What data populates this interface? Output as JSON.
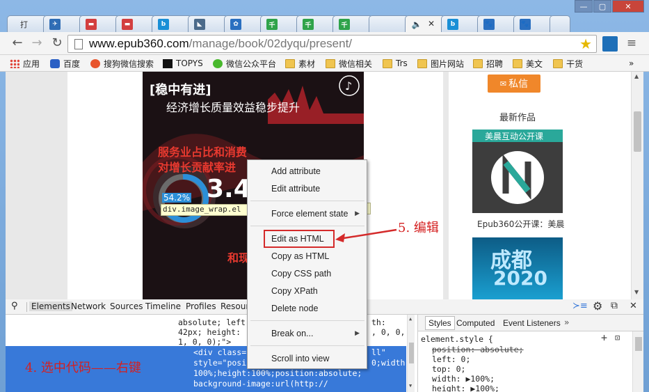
{
  "tabs": [
    {
      "label": "打",
      "color": "#9aa7b8"
    },
    {
      "label": "",
      "color": "#2f6db5"
    },
    {
      "label": "",
      "color": "#d33f3f"
    },
    {
      "label": "",
      "color": "#d33f3f"
    },
    {
      "label": "",
      "color": "#1a8fd6"
    },
    {
      "label": "",
      "color": "#4b6a8a"
    },
    {
      "label": "",
      "color": "#2a6fc0"
    },
    {
      "label": "",
      "color": "#2fa34a"
    },
    {
      "label": "",
      "color": "#2fa34a"
    },
    {
      "label": "",
      "color": "#2fa34a"
    },
    {
      "label": "",
      "color": "#333333"
    },
    {
      "label": "",
      "color": "#1a8fd6"
    },
    {
      "label": "",
      "color": "#2a6fc0"
    },
    {
      "label": "",
      "color": "#2a6fc0"
    }
  ],
  "address_bar": {
    "domain": "www.epub360.com",
    "path": "/manage/book/02dyqu/present/"
  },
  "bookmarks": [
    {
      "label": "应用",
      "icon": "apps-icon"
    },
    {
      "label": "百度",
      "icon": "baidu-icon"
    },
    {
      "label": "搜狗微信搜索",
      "icon": "sogou-icon"
    },
    {
      "label": "TOPYS",
      "icon": "topys-icon"
    },
    {
      "label": "微信公众平台",
      "icon": "wechat-icon"
    },
    {
      "label": "素材",
      "icon": "folder-icon"
    },
    {
      "label": "微信相关",
      "icon": "folder-icon"
    },
    {
      "label": "Trs",
      "icon": "folder-icon"
    },
    {
      "label": "图片网站",
      "icon": "folder-icon"
    },
    {
      "label": "招聘",
      "icon": "folder-icon"
    },
    {
      "label": "美文",
      "icon": "folder-icon"
    },
    {
      "label": "干货",
      "icon": "folder-icon"
    }
  ],
  "poster": {
    "title": "[稳中有进]",
    "subtitle": "经济增长质量效益稳步提升",
    "headline1": "服务业占比和消费",
    "headline2": "对增长贡献率进",
    "percent": "54.2%",
    "big_number": "3.4",
    "element_tooltip": "div.image_wrap.el",
    "bottom_text": "和现"
  },
  "sidebar": {
    "message_button": "私信",
    "latest_works": "最新作品",
    "thumb1_banner": "美晨互动公开课",
    "thumb1_caption": "Epub360公开课：美晨",
    "thumb2_text": "成都",
    "thumb2_year": "2020"
  },
  "devtools": {
    "tabs": [
      "Elements",
      "Network",
      "Sources",
      "Timeline",
      "Profiles",
      "Resour"
    ],
    "code_lines": [
      "absolute; left",
      "42px; height:",
      "1, 0, 0);\">",
      "<div class=",
      "style=\"posi",
      "100%;height:100%;position:absolute;",
      "background-image:url(http://"
    ],
    "code_right": [
      "th:",
      ", 0, 0,",
      "ll\"",
      "0;width:"
    ],
    "styles_tabs": [
      "Styles",
      "Computed",
      "Event Listeners",
      "»"
    ],
    "styles": {
      "selector": "element.style {",
      "props": [
        {
          "text": "position: absolute;",
          "struck": true
        },
        {
          "text": "left: 0;",
          "struck": false
        },
        {
          "text": "top: 0;",
          "struck": false
        },
        {
          "text": "width: ▶100%;",
          "struck": false
        },
        {
          "text": "height: ▶100%;",
          "struck": false
        }
      ]
    }
  },
  "context_menu": {
    "items": [
      "Add attribute",
      "Edit attribute",
      "Force element state",
      "Edit as HTML",
      "Copy as HTML",
      "Copy CSS path",
      "Copy XPath",
      "Delete node",
      "Break on...",
      "Scroll into view"
    ]
  },
  "annotations": {
    "step5": "5. 编辑",
    "step4": "4. 选中代码——右键"
  },
  "colors": {
    "accent_red": "#d42a2a",
    "selection_blue": "#3879d9",
    "message_orange": "#f0872a"
  }
}
